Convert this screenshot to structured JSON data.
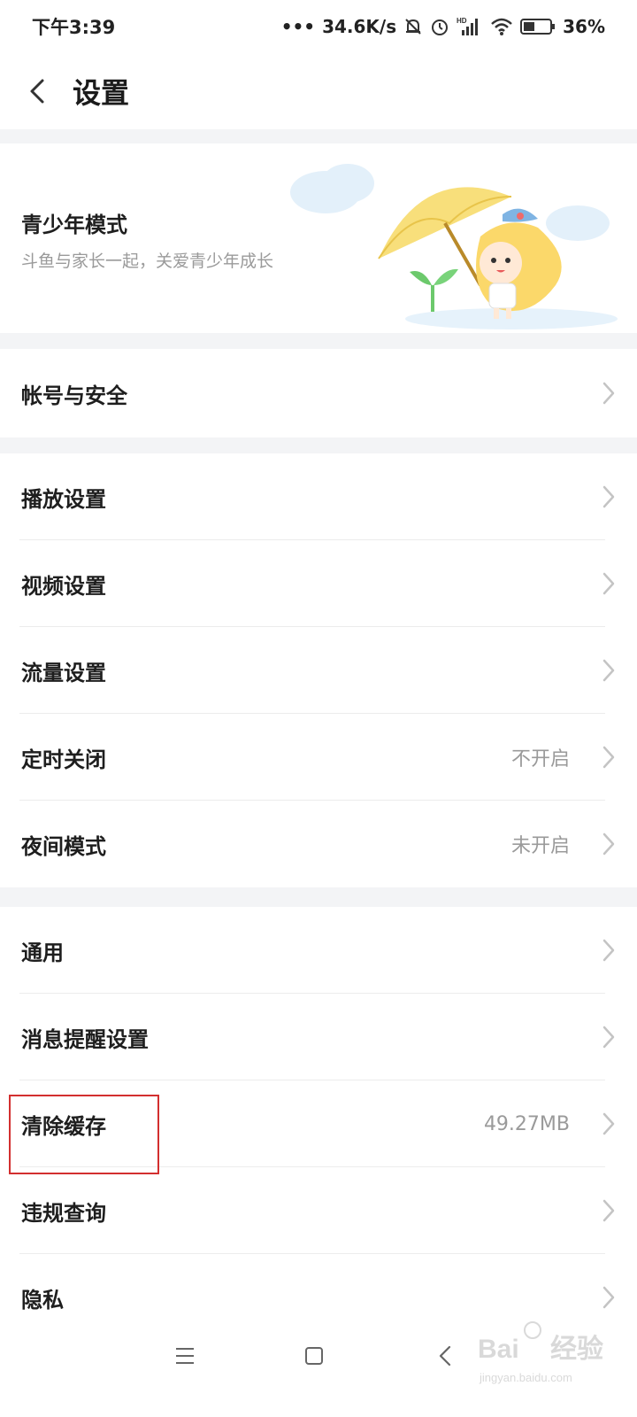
{
  "status_bar": {
    "time": "下午3:39",
    "network_speed": "34.6K/s",
    "signal_label": "HD",
    "battery": "36%"
  },
  "header": {
    "title": "设置"
  },
  "youth_mode": {
    "title": "青少年模式",
    "subtitle": "斗鱼与家长一起，关爱青少年成长"
  },
  "account_group": [
    {
      "label": "帐号与安全",
      "value": ""
    }
  ],
  "play_group": [
    {
      "label": "播放设置",
      "value": ""
    },
    {
      "label": "视频设置",
      "value": ""
    },
    {
      "label": "流量设置",
      "value": ""
    },
    {
      "label": "定时关闭",
      "value": "不开启"
    },
    {
      "label": "夜间模式",
      "value": "未开启"
    }
  ],
  "general_group": [
    {
      "label": "通用",
      "value": ""
    },
    {
      "label": "消息提醒设置",
      "value": ""
    },
    {
      "label": "清除缓存",
      "value": "49.27MB"
    },
    {
      "label": "违规查询",
      "value": ""
    },
    {
      "label": "隐私",
      "value": ""
    }
  ],
  "nav_bar": {
    "icons": [
      "menu-icon",
      "home-square-icon",
      "back-triangle-icon"
    ]
  },
  "watermark": {
    "brand": "Bai",
    "brand2": "经验",
    "url": "jingyan.baidu.com"
  },
  "colors": {
    "background": "#f3f4f6",
    "text": "#1e1e1e",
    "secondary_text": "#9a9a9a",
    "highlight_border": "#d32f2f"
  }
}
